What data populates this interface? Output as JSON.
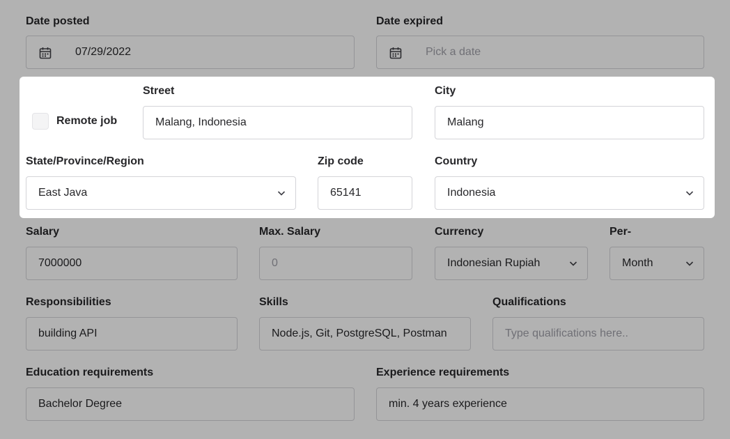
{
  "date_posted": {
    "label": "Date posted",
    "value": "07/29/2022",
    "icon": "calendar-icon"
  },
  "date_expired": {
    "label": "Date expired",
    "placeholder": "Pick a date",
    "icon": "calendar-icon"
  },
  "remote_job": {
    "label": "Remote job",
    "checked": false
  },
  "street": {
    "label": "Street",
    "value": "Malang, Indonesia"
  },
  "city": {
    "label": "City",
    "value": "Malang"
  },
  "state": {
    "label": "State/Province/Region",
    "value": "East Java",
    "icon": "chevron-down-icon"
  },
  "zip": {
    "label": "Zip code",
    "value": "65141"
  },
  "country": {
    "label": "Country",
    "value": "Indonesia",
    "icon": "chevron-down-icon"
  },
  "salary": {
    "label": "Salary",
    "value": "7000000"
  },
  "max_salary": {
    "label": "Max. Salary",
    "placeholder": "0"
  },
  "currency": {
    "label": "Currency",
    "value": "Indonesian Rupiah",
    "icon": "chevron-down-icon"
  },
  "per": {
    "label": "Per-",
    "value": "Month",
    "icon": "chevron-down-icon"
  },
  "responsibilities": {
    "label": "Responsibilities",
    "value": "building API"
  },
  "skills": {
    "label": "Skills",
    "value": "Node.js, Git, PostgreSQL, Postman"
  },
  "qualifications": {
    "label": "Qualifications",
    "placeholder": "Type qualifications here.."
  },
  "education": {
    "label": "Education requirements",
    "value": "Bachelor Degree"
  },
  "experience": {
    "label": "Experience requirements",
    "value": "min. 4 years experience"
  },
  "colors": {
    "overlay": "rgba(0,0,0,0.30)",
    "border": "#d4d4d8",
    "text": "#27272a",
    "placeholder": "#a1a1aa"
  }
}
